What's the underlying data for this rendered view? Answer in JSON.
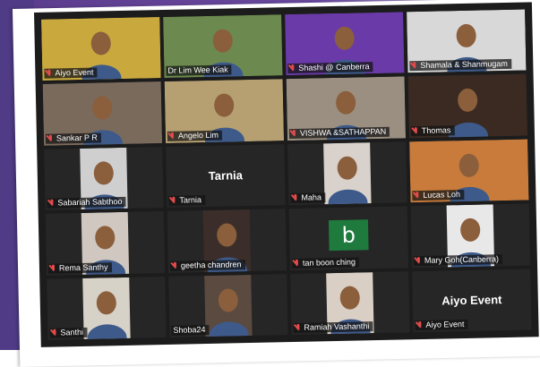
{
  "meeting": {
    "participants": [
      {
        "name": "Aiyo Event",
        "muted": true,
        "active": true,
        "bg": "#c9a93e",
        "type": "banner"
      },
      {
        "name": "Dr Lim Wee Kiak",
        "muted": false,
        "active": false,
        "bg": "#6c8a4f",
        "type": "video"
      },
      {
        "name": "Shashi @ Canberra",
        "muted": true,
        "active": false,
        "bg": "#6a3aa8",
        "type": "video"
      },
      {
        "name": "Shamala & Shanmugam",
        "muted": true,
        "active": false,
        "bg": "#d8d8d8",
        "type": "video"
      },
      {
        "name": "Sankar P R",
        "muted": true,
        "active": false,
        "bg": "#7a6a5c",
        "type": "video"
      },
      {
        "name": "Angelo Lim",
        "muted": true,
        "active": false,
        "bg": "#b6a071",
        "type": "video"
      },
      {
        "name": "VISHWA &SATHAPPAN",
        "muted": true,
        "active": false,
        "bg": "#9a8f80",
        "type": "video"
      },
      {
        "name": "Thomas",
        "muted": true,
        "active": false,
        "bg": "#3a2a22",
        "type": "video"
      },
      {
        "name": "Sabariah Sabthoo",
        "muted": true,
        "active": false,
        "bg": "#cfcfcf",
        "type": "video"
      },
      {
        "name": "Tarnia",
        "muted": true,
        "active": false,
        "bg": "#262626",
        "type": "nameonly",
        "display": "Tarnia"
      },
      {
        "name": "Maha",
        "muted": true,
        "active": false,
        "bg": "#d9d2cc",
        "type": "video"
      },
      {
        "name": "Lucas Loh",
        "muted": true,
        "active": false,
        "bg": "#c87b3b",
        "type": "video"
      },
      {
        "name": "Rema Santhy",
        "muted": true,
        "active": false,
        "bg": "#cfc7c0",
        "type": "video"
      },
      {
        "name": "geetha chandren",
        "muted": true,
        "active": false,
        "bg": "#3b2e2a",
        "type": "video"
      },
      {
        "name": "tan boon ching",
        "muted": true,
        "active": false,
        "bg": "#262626",
        "type": "logo",
        "logo": "b"
      },
      {
        "name": "Mary Goh(Canberra)",
        "muted": true,
        "active": false,
        "bg": "#e8e8e8",
        "type": "video"
      },
      {
        "name": "Santhi",
        "muted": true,
        "active": false,
        "bg": "#d7d2c8",
        "type": "video"
      },
      {
        "name": "Shoba24",
        "muted": false,
        "active": false,
        "bg": "#5a4a40",
        "type": "video"
      },
      {
        "name": "Ramiah Vashanthi",
        "muted": true,
        "active": false,
        "bg": "#d9cfc4",
        "type": "video"
      },
      {
        "name": "Aiyo Event",
        "muted": true,
        "active": false,
        "bg": "#262626",
        "type": "nameonly",
        "display": "Aiyo Event"
      }
    ]
  }
}
